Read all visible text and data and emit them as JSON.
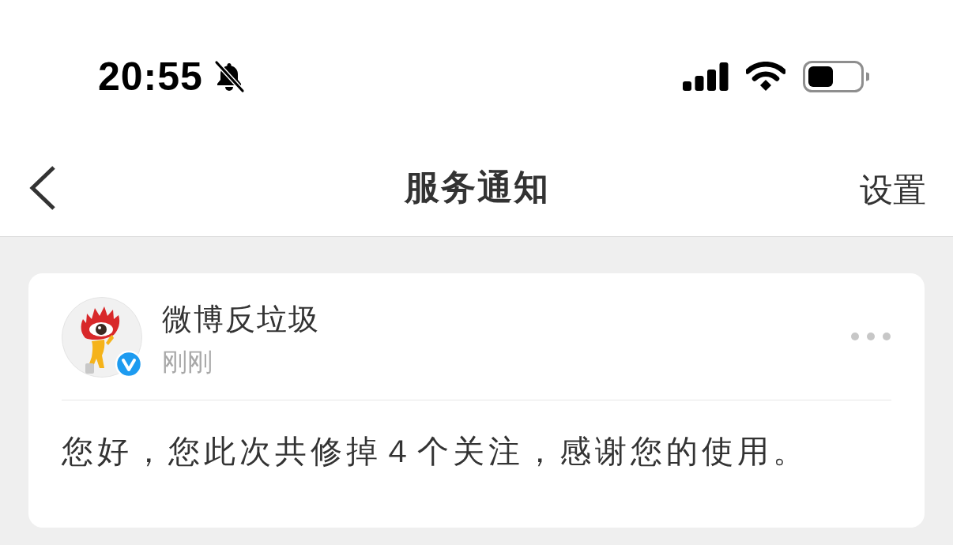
{
  "status_bar": {
    "time": "20:55",
    "silent": true
  },
  "nav": {
    "title": "服务通知",
    "action": "设置"
  },
  "notices": [
    {
      "sender": "微博反垃圾",
      "verified": true,
      "time": "刚刚",
      "message": "您好，您此次共修掉４个关注，感谢您的使用。"
    }
  ]
}
